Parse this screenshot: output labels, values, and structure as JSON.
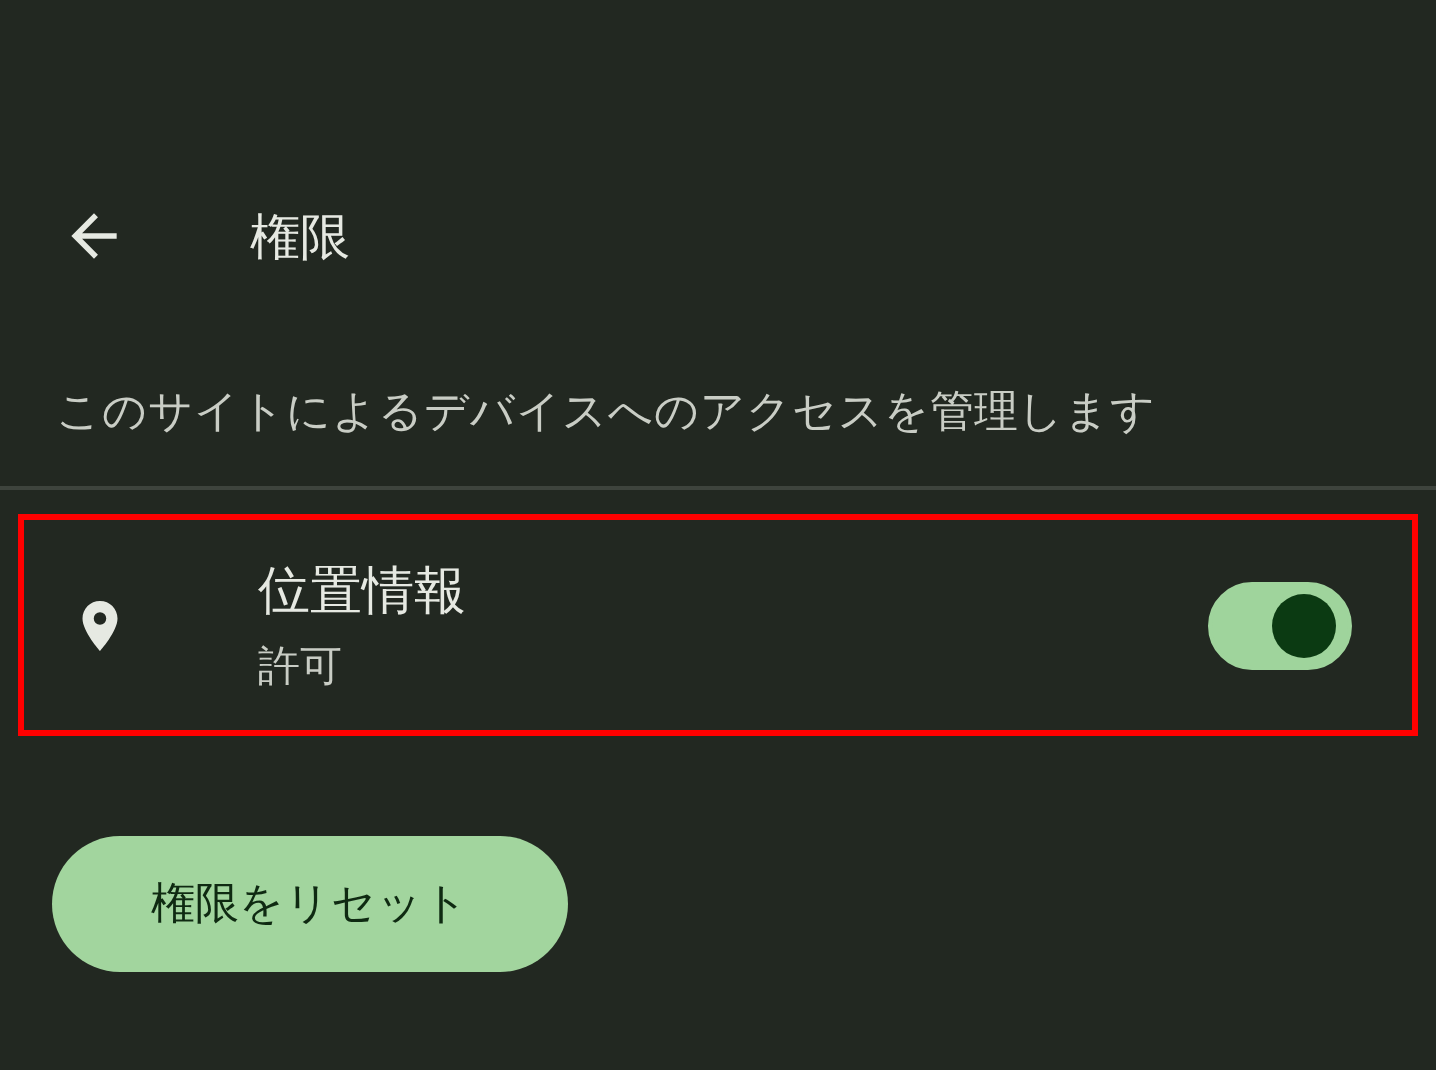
{
  "header": {
    "title": "権限"
  },
  "description": "このサイトによるデバイスへのアクセスを管理します",
  "permissions": [
    {
      "title": "位置情報",
      "status": "許可",
      "on": true,
      "highlighted": true
    }
  ],
  "reset_button": {
    "label": "権限をリセット"
  }
}
